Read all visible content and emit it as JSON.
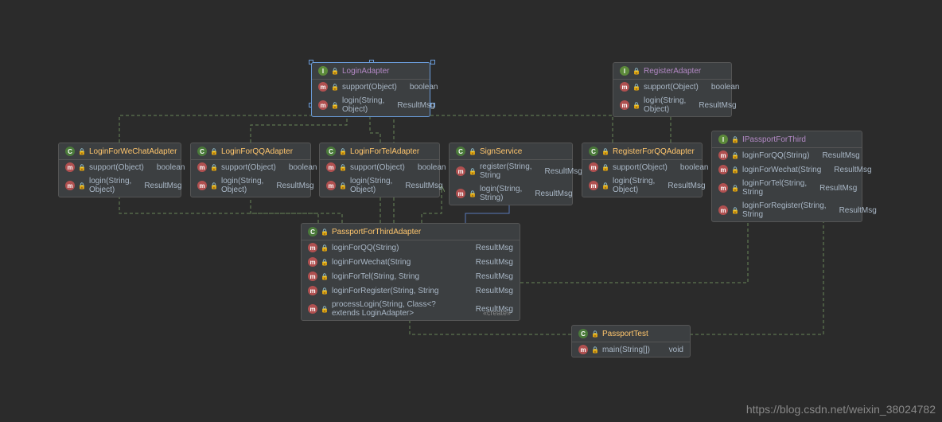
{
  "watermark": "https://blog.csdn.net/weixin_38024782",
  "stereotype_create": "«create»",
  "classes": {
    "loginAdapter": {
      "name": "LoginAdapter",
      "type": "interface",
      "methods": [
        {
          "sig": "support(Object)",
          "ret": "boolean"
        },
        {
          "sig": "login(String, Object)",
          "ret": "ResultMsg"
        }
      ]
    },
    "registerAdapter": {
      "name": "RegisterAdapter",
      "type": "interface",
      "methods": [
        {
          "sig": "support(Object)",
          "ret": "boolean"
        },
        {
          "sig": "login(String, Object)",
          "ret": "ResultMsg"
        }
      ]
    },
    "loginForWeChat": {
      "name": "LoginForWeChatAdapter",
      "type": "class",
      "methods": [
        {
          "sig": "support(Object)",
          "ret": "boolean"
        },
        {
          "sig": "login(String, Object)",
          "ret": "ResultMsg"
        }
      ]
    },
    "loginForQQ": {
      "name": "LoginForQQAdapter",
      "type": "class",
      "methods": [
        {
          "sig": "support(Object)",
          "ret": "boolean"
        },
        {
          "sig": "login(String, Object)",
          "ret": "ResultMsg"
        }
      ]
    },
    "loginForTel": {
      "name": "LoginForTelAdapter",
      "type": "class",
      "methods": [
        {
          "sig": "support(Object)",
          "ret": "boolean"
        },
        {
          "sig": "login(String, Object)",
          "ret": "ResultMsg"
        }
      ]
    },
    "signService": {
      "name": "SignService",
      "type": "class",
      "methods": [
        {
          "sig": "register(String, String",
          "ret": "ResultMsg"
        },
        {
          "sig": "login(String, String)",
          "ret": "ResultMsg"
        }
      ]
    },
    "registerForQQ": {
      "name": "RegisterForQQAdapter",
      "type": "class",
      "methods": [
        {
          "sig": "support(Object)",
          "ret": "boolean"
        },
        {
          "sig": "login(String, Object)",
          "ret": "ResultMsg"
        }
      ]
    },
    "ipassport": {
      "name": "IPassportForThird",
      "type": "interface",
      "methods": [
        {
          "sig": "loginForQQ(String)",
          "ret": "ResultMsg"
        },
        {
          "sig": "loginForWechat(String",
          "ret": "ResultMsg"
        },
        {
          "sig": "loginForTel(String, String",
          "ret": "ResultMsg"
        },
        {
          "sig": "loginForRegister(String, String",
          "ret": "ResultMsg"
        }
      ]
    },
    "passportAdapter": {
      "name": "PassportForThirdAdapter",
      "type": "class",
      "methods": [
        {
          "sig": "loginForQQ(String)",
          "ret": "ResultMsg"
        },
        {
          "sig": "loginForWechat(String",
          "ret": "ResultMsg"
        },
        {
          "sig": "loginForTel(String, String",
          "ret": "ResultMsg"
        },
        {
          "sig": "loginForRegister(String, String",
          "ret": "ResultMsg"
        },
        {
          "sig": "processLogin(String, Class<? extends LoginAdapter>",
          "ret": "ResultMsg",
          "priv": true
        }
      ]
    },
    "passportTest": {
      "name": "PassportTest",
      "type": "class",
      "methods": [
        {
          "sig": "main(String[])",
          "ret": "void"
        }
      ]
    }
  }
}
